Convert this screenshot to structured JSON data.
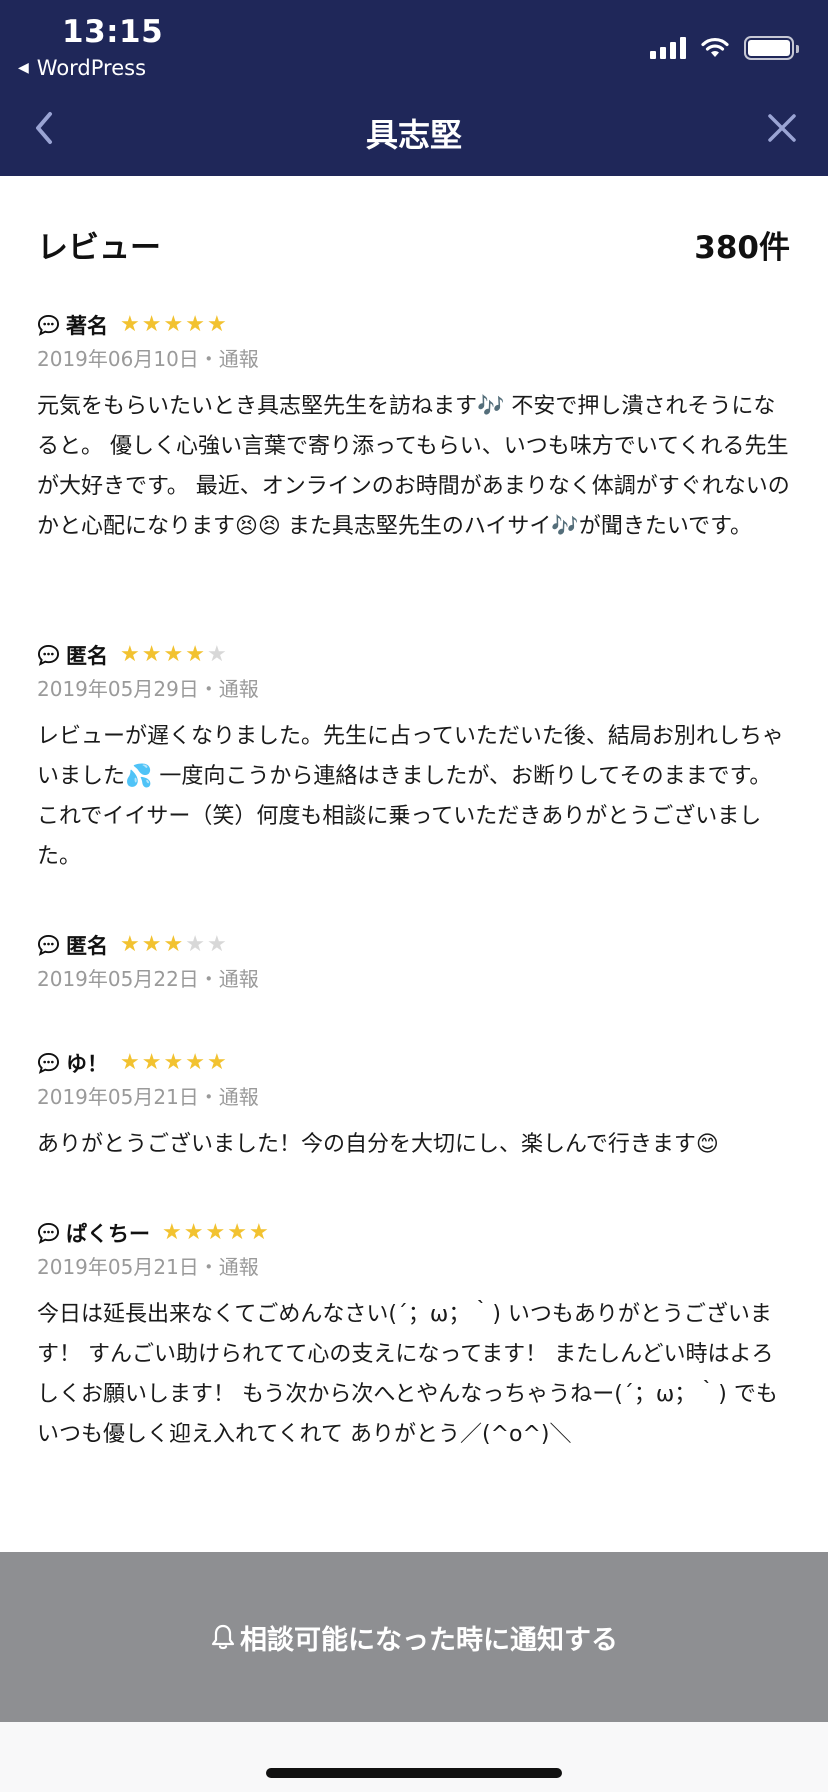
{
  "status_bar": {
    "time": "13:15",
    "back_app": "WordPress"
  },
  "nav": {
    "title": "具志堅"
  },
  "reviews": {
    "heading": "レビュー",
    "count": "380件",
    "items": [
      {
        "name": "著名",
        "rating": 5,
        "date": "2019年06月10日",
        "separator": "・",
        "report": "通報",
        "body": "元気をもらいたいとき具志堅先生を訪ねます🎶 不安で押し潰されそうになると。 優しく心強い言葉で寄り添ってもらい、いつも味方でいてくれる先生が大好きです。 最近、オンラインのお時間があまりなく体調がすぐれないのかと心配になります😣😣 また具志堅先生のハイサイ🎶が聞きたいです。"
      },
      {
        "name": "匿名",
        "rating": 4,
        "date": "2019年05月29日",
        "separator": "・",
        "report": "通報",
        "body": "レビューが遅くなりました。先生に占っていただいた後、結局お別れしちゃいました💦 一度向こうから連絡はきましたが、お断りしてそのままです。これでイイサー（笑）何度も相談に乗っていただきありがとうございました。"
      },
      {
        "name": "匿名",
        "rating": 3,
        "date": "2019年05月22日",
        "separator": "・",
        "report": "通報",
        "body": ""
      },
      {
        "name": "ゆ！",
        "rating": 5,
        "date": "2019年05月21日",
        "separator": "・",
        "report": "通報",
        "body": "ありがとうございました！今の自分を大切にし、楽しんで行きます😊"
      },
      {
        "name": "ぱくちー",
        "rating": 5,
        "date": "2019年05月21日",
        "separator": "・",
        "report": "通報",
        "body": "今日は延長出来なくてごめんなさい(´；ω；｀) いつもありがとうございます！ すんごい助けられてて心の支えになってます！ またしんどい時はよろしくお願いします！ もう次から次へとやんなっちゃうねー(´；ω；｀) でもいつも優しく迎え入れてくれて ありがとう／(^o^)＼"
      }
    ]
  },
  "cta": {
    "label": "相談可能になった時に通知する"
  },
  "colors": {
    "header_bg": "#1f2759",
    "star_on": "#f2c230",
    "star_off": "#d8d8d8",
    "cta_bg": "#8e8f92"
  }
}
